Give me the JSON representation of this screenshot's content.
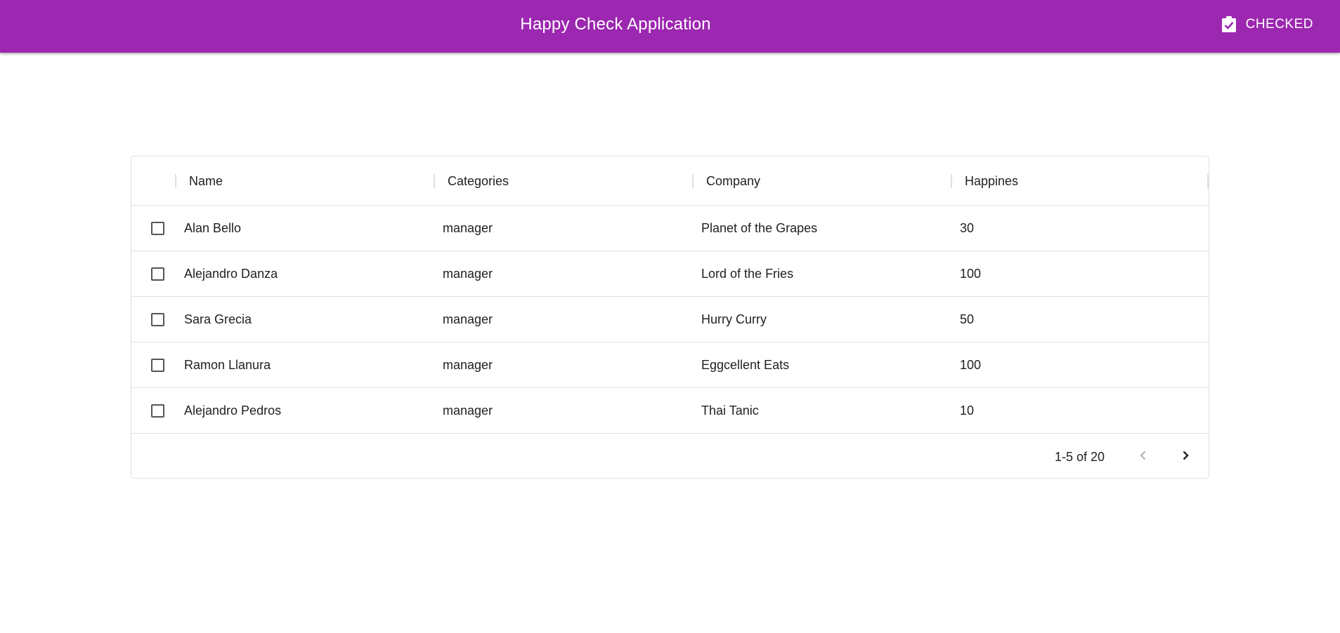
{
  "header": {
    "title": "Happy Check Application",
    "checked_label": "CHECKED",
    "checked_icon": "clipboard-check-icon",
    "color": "#9c27b0"
  },
  "table": {
    "columns": [
      "Name",
      "Categories",
      "Company",
      "Happines"
    ],
    "rows": [
      {
        "name": "Alan Bello",
        "category": "manager",
        "company": "Planet of the Grapes",
        "happiness": "30"
      },
      {
        "name": "Alejandro Danza",
        "category": "manager",
        "company": "Lord of the Fries",
        "happiness": "100"
      },
      {
        "name": "Sara Grecia",
        "category": "manager",
        "company": "Hurry Curry",
        "happiness": "50"
      },
      {
        "name": "Ramon Llanura",
        "category": "manager",
        "company": "Eggcellent Eats",
        "happiness": "100"
      },
      {
        "name": "Alejandro Pedros",
        "category": "manager",
        "company": "Thai Tanic",
        "happiness": "10"
      }
    ]
  },
  "pagination": {
    "range_text": "1-5 of 20",
    "prev_icon": "chevron-left-icon",
    "next_icon": "chevron-right-icon"
  }
}
